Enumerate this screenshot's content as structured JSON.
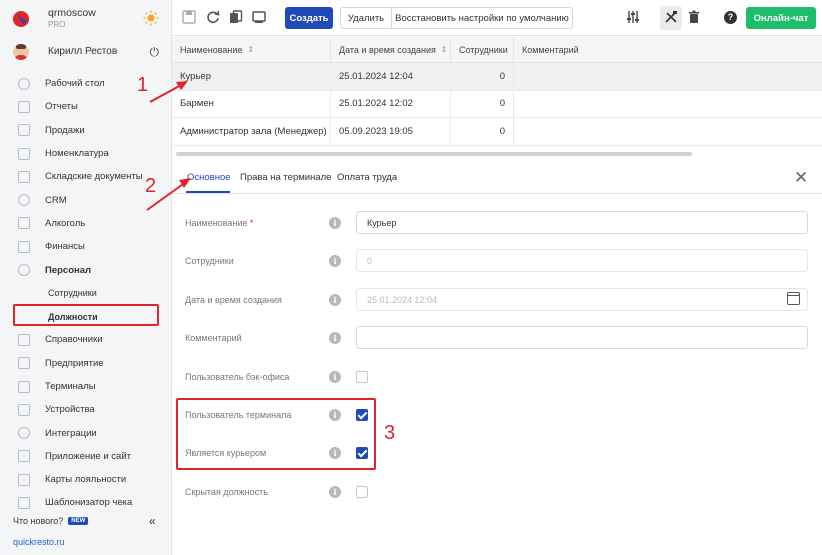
{
  "brand": {
    "name": "qrmoscow",
    "plan": "PRO"
  },
  "user": {
    "name": "Кирилл Рестов"
  },
  "sidebar": {
    "items": [
      {
        "label": "Рабочий стол",
        "icon": "dashboard-icon"
      },
      {
        "label": "Отчеты",
        "icon": "reports-icon"
      },
      {
        "label": "Продажи",
        "icon": "sales-icon"
      },
      {
        "label": "Номенклатура",
        "icon": "tag-icon"
      },
      {
        "label": "Складские документы",
        "icon": "warehouse-icon"
      },
      {
        "label": "CRM",
        "icon": "crm-icon"
      },
      {
        "label": "Алкоголь",
        "icon": "glass-icon"
      },
      {
        "label": "Финансы",
        "icon": "finance-icon"
      },
      {
        "label": "Персонал",
        "icon": "people-icon"
      }
    ],
    "sub_items": [
      {
        "label": "Сотрудники"
      },
      {
        "label": "Должности"
      }
    ],
    "items_after": [
      {
        "label": "Справочники",
        "icon": "book-icon"
      },
      {
        "label": "Предприятие",
        "icon": "building-icon"
      },
      {
        "label": "Терминалы",
        "icon": "terminal-icon"
      },
      {
        "label": "Устройства",
        "icon": "printer-icon"
      },
      {
        "label": "Интеграции",
        "icon": "link-icon"
      },
      {
        "label": "Приложение и сайт",
        "icon": "app-icon"
      },
      {
        "label": "Карты лояльности",
        "icon": "card-icon"
      },
      {
        "label": "Шаблонизатор чека",
        "icon": "receipt-icon"
      }
    ],
    "whats_new": "Что нового?",
    "new_badge": "NEW",
    "site": "quickresto.ru"
  },
  "toolbar": {
    "create": "Создать",
    "delete": "Удалить",
    "restore": "Восстановить настройки по умолчанию",
    "chat": "Онлайн-чат"
  },
  "table": {
    "headers": [
      "Наименование",
      "Дата и время создания",
      "Сотрудники",
      "Комментарий"
    ],
    "rows": [
      {
        "name": "Курьер",
        "created": "25.01.2024 12:04",
        "staff": "0",
        "comment": ""
      },
      {
        "name": "Бармен",
        "created": "25.01.2024 12:02",
        "staff": "0",
        "comment": ""
      },
      {
        "name": "Администратор зала (Менеджер)",
        "created": "05.09.2023 19:05",
        "staff": "0",
        "comment": ""
      }
    ]
  },
  "tabs": [
    "Основное",
    "Права на терминале",
    "Оплата труда"
  ],
  "form": {
    "name_label": "Наименование",
    "name_value": "Курьер",
    "staff_label": "Сотрудники",
    "staff_value": "0",
    "created_label": "Дата и время создания",
    "created_value": "25.01.2024 12:04",
    "comment_label": "Комментарий",
    "comment_value": "",
    "backoffice_label": "Пользователь бэк-офиса",
    "backoffice_checked": false,
    "terminal_label": "Пользователь терминала",
    "terminal_checked": true,
    "courier_label": "Является курьером",
    "courier_checked": true,
    "hidden_label": "Скрытая должность",
    "hidden_checked": false
  },
  "annotations": [
    "1",
    "2",
    "3"
  ],
  "colors": {
    "accent": "#1f4ab8",
    "chat": "#1dbe6b",
    "annotation": "#e0242c"
  }
}
